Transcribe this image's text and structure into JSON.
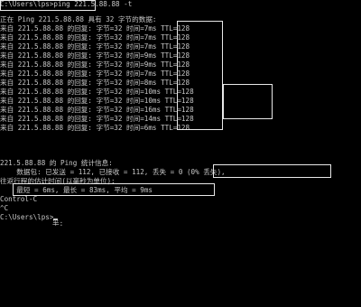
{
  "console": {
    "prompt_line": "C:\\Users\\lps>ping 221.5.88.88 -t",
    "header_line": "正在 Ping 221.5.88.88 具有 32 字节的数据:",
    "replies": [
      "来自 221.5.88.88 的回复: 字节=32 时间=7ms TTL=128",
      "来自 221.5.88.88 的回复: 字节=32 时间=7ms TTL=128",
      "来自 221.5.88.88 的回复: 字节=32 时间=7ms TTL=128",
      "来自 221.5.88.88 的回复: 字节=32 时间=9ms TTL=128",
      "来自 221.5.88.88 的回复: 字节=32 时间=9ms TTL=128",
      "来自 221.5.88.88 的回复: 字节=32 时间=7ms TTL=128",
      "来自 221.5.88.88 的回复: 字节=32 时间=8ms TTL=128",
      "来自 221.5.88.88 的回复: 字节=32 时间=10ms TTL=128",
      "来自 221.5.88.88 的回复: 字节=32 时间=10ms TTL=128",
      "来自 221.5.88.88 的回复: 字节=32 时间=16ms TTL=128",
      "来自 221.5.88.88 的回复: 字节=32 时间=14ms TTL=128",
      "来自 221.5.88.88 的回复: 字节=32 时间=6ms TTL=128"
    ],
    "stats_title": "221.5.88.88 的 Ping 统计信息:",
    "stats_packets": "    数据包: 已发送 = 112, 已接收 = 112, 丢失 = 0 (0% 丢失),",
    "rtt_title": "往返行程的估计时间(以毫秒为单位):",
    "rtt_values": "    最短 = 6ms, 最长 = 83ms, 平均 = 9ms",
    "control_c": "Control-C",
    "ctrl_c_echo": "^C",
    "final_prompt": "C:\\Users\\lps>",
    "ime_status": "半:"
  }
}
